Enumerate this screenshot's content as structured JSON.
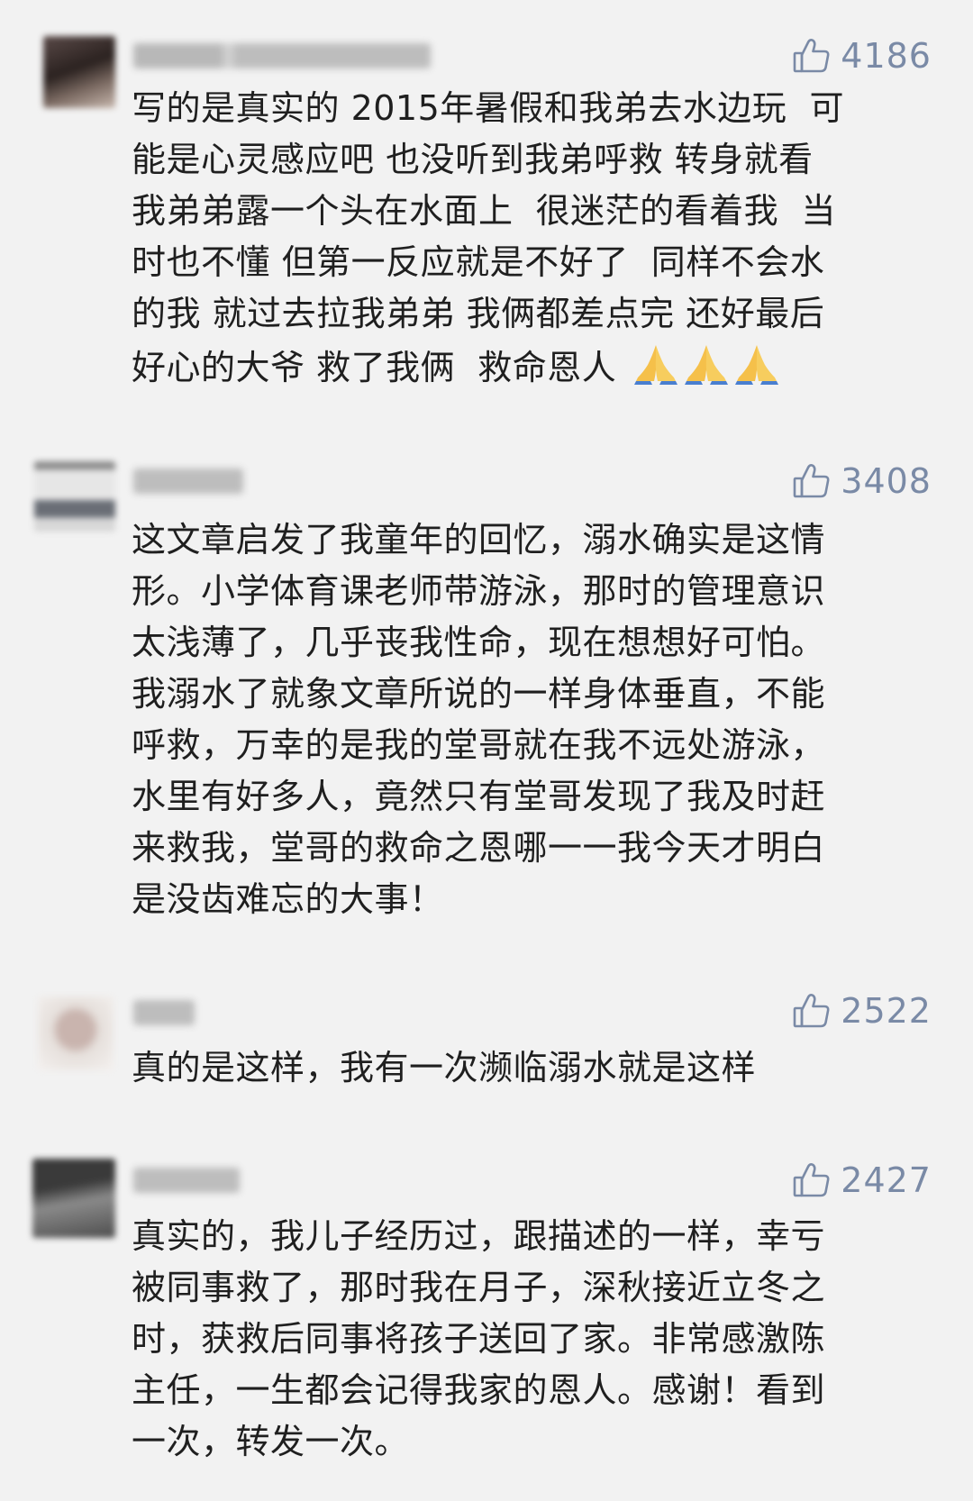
{
  "comments": [
    {
      "likes": "4186",
      "lines": [
        "写的是真实的 2015年暑假和我弟去水边玩  可",
        "能是心灵感应吧 也没听到我弟呼救 转身就看",
        "我弟弟露一个头在水面上  很迷茫的看着我  当",
        "时也不懂 但第一反应就是不好了  同样不会水",
        "的我 就过去拉我弟弟 我俩都差点完 还好最后",
        "好心的大爷 救了我俩  救命恩人"
      ],
      "emoji": [
        "folded-hands-emoji",
        "folded-hands-emoji",
        "folded-hands-emoji"
      ]
    },
    {
      "likes": "3408",
      "lines": [
        "这文章启发了我童年的回忆，溺水确实是这情",
        "形。小学体育课老师带游泳，那时的管理意识",
        "太浅薄了，几乎丧我性命，现在想想好可怕。",
        "我溺水了就象文章所说的一样身体垂直，不能",
        "呼救，万幸的是我的堂哥就在我不远处游泳，",
        "水里有好多人，竟然只有堂哥发现了我及时赶",
        "来救我，堂哥的救命之恩哪一一我今天才明白",
        "是没齿难忘的大事！"
      ]
    },
    {
      "likes": "2522",
      "lines": [
        "真的是这样，我有一次濒临溺水就是这样"
      ]
    },
    {
      "likes": "2427",
      "lines": [
        "真实的，我儿子经历过，跟描述的一样，幸亏",
        "被同事救了，那时我在月子，深秋接近立冬之",
        "时，获救后同事将孩子送回了家。非常感激陈",
        "主任，一生都会记得我家的恩人。感谢！看到",
        "一次，转发一次。"
      ]
    }
  ],
  "colors": {
    "background": "#f2f2f2",
    "text": "#1f1f1f",
    "like": "#7a8aa6"
  }
}
